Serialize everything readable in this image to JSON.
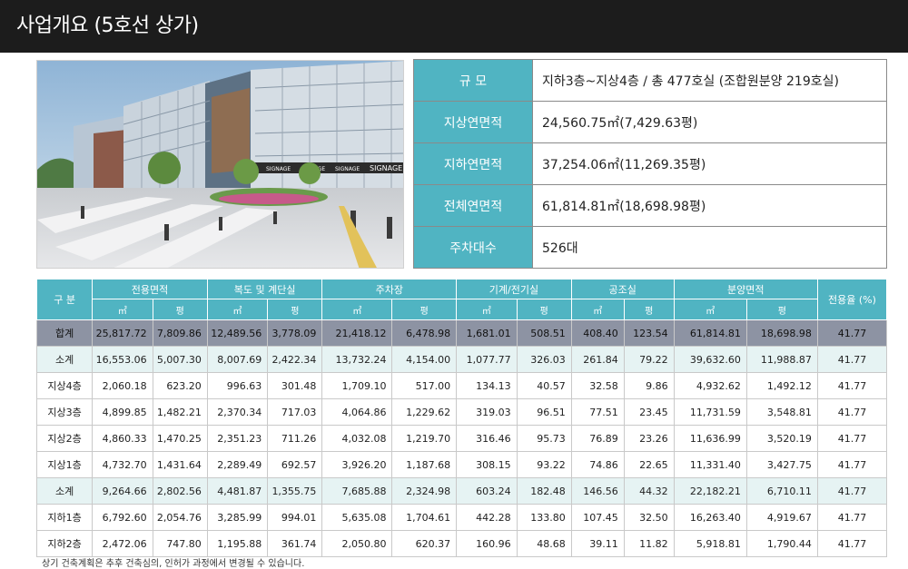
{
  "page": {
    "title": "사업개요 (5호선 상가)"
  },
  "overview": [
    {
      "key": "규 모",
      "value": "지하3층~지상4층 / 총 477호실 (조합원분양 219호실)"
    },
    {
      "key": "지상연면적",
      "value": "24,560.75㎡(7,429.63평)"
    },
    {
      "key": "지하연면적",
      "value": "37,254.06㎡(11,269.35평)"
    },
    {
      "key": "전체연면적",
      "value": "61,814.81㎡(18,698.98평)"
    },
    {
      "key": "주차대수",
      "value": "526대"
    }
  ],
  "rendering": {
    "signage": "SIGNAGE"
  },
  "table": {
    "floor_header": "구 분",
    "groups": [
      "전용면적",
      "복도 및 계단실",
      "주차장",
      "기계/전기실",
      "공조실",
      "분양면적"
    ],
    "rate_header": "전용율 (%)",
    "unit_m2": "㎡",
    "unit_py": "평",
    "rows": [
      {
        "label": "합계",
        "kind": "total",
        "cells": [
          "25,817.72",
          "7,809.86",
          "12,489.56",
          "3,778.09",
          "21,418.12",
          "6,478.98",
          "1,681.01",
          "508.51",
          "408.40",
          "123.54",
          "61,814.81",
          "18,698.98",
          "41.77"
        ]
      },
      {
        "label": "소계",
        "kind": "sub",
        "cells": [
          "16,553.06",
          "5,007.30",
          "8,007.69",
          "2,422.34",
          "13,732.24",
          "4,154.00",
          "1,077.77",
          "326.03",
          "261.84",
          "79.22",
          "39,632.60",
          "11,988.87",
          "41.77"
        ]
      },
      {
        "label": "지상4층",
        "kind": "plain",
        "cells": [
          "2,060.18",
          "623.20",
          "996.63",
          "301.48",
          "1,709.10",
          "517.00",
          "134.13",
          "40.57",
          "32.58",
          "9.86",
          "4,932.62",
          "1,492.12",
          "41.77"
        ]
      },
      {
        "label": "지상3층",
        "kind": "plain",
        "cells": [
          "4,899.85",
          "1,482.21",
          "2,370.34",
          "717.03",
          "4,064.86",
          "1,229.62",
          "319.03",
          "96.51",
          "77.51",
          "23.45",
          "11,731.59",
          "3,548.81",
          "41.77"
        ]
      },
      {
        "label": "지상2층",
        "kind": "plain",
        "cells": [
          "4,860.33",
          "1,470.25",
          "2,351.23",
          "711.26",
          "4,032.08",
          "1,219.70",
          "316.46",
          "95.73",
          "76.89",
          "23.26",
          "11,636.99",
          "3,520.19",
          "41.77"
        ]
      },
      {
        "label": "지상1층",
        "kind": "plain",
        "cells": [
          "4,732.70",
          "1,431.64",
          "2,289.49",
          "692.57",
          "3,926.20",
          "1,187.68",
          "308.15",
          "93.22",
          "74.86",
          "22.65",
          "11,331.40",
          "3,427.75",
          "41.77"
        ]
      },
      {
        "label": "소계",
        "kind": "sub",
        "cells": [
          "9,264.66",
          "2,802.56",
          "4,481.87",
          "1,355.75",
          "7,685.88",
          "2,324.98",
          "603.24",
          "182.48",
          "146.56",
          "44.32",
          "22,182.21",
          "6,710.11",
          "41.77"
        ]
      },
      {
        "label": "지하1층",
        "kind": "plain",
        "cells": [
          "6,792.60",
          "2,054.76",
          "3,285.99",
          "994.01",
          "5,635.08",
          "1,704.61",
          "442.28",
          "133.80",
          "107.45",
          "32.50",
          "16,263.40",
          "4,919.67",
          "41.77"
        ]
      },
      {
        "label": "지하2층",
        "kind": "plain",
        "cells": [
          "2,472.06",
          "747.80",
          "1,195.88",
          "361.74",
          "2,050.80",
          "620.37",
          "160.96",
          "48.68",
          "39.11",
          "11.82",
          "5,918.81",
          "1,790.44",
          "41.77"
        ]
      }
    ]
  },
  "footnote": "상기 건축계획은 추후 건축심의, 인허가 과정에서 변경될 수 있습니다."
}
